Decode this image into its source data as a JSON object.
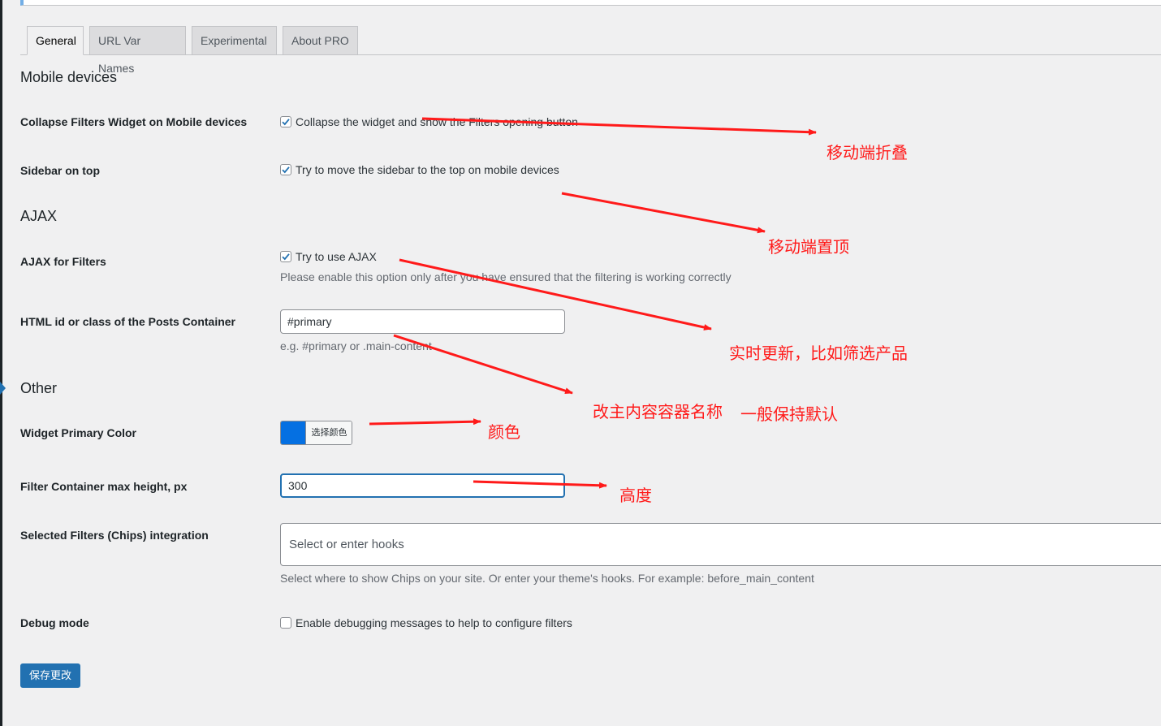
{
  "tabs": [
    {
      "label": "General",
      "active": true
    },
    {
      "label": "URL Var Names",
      "active": false
    },
    {
      "label": "Experimental",
      "active": false
    },
    {
      "label": "About PRO",
      "active": false
    }
  ],
  "sections": {
    "mobile": "Mobile devices",
    "ajax": "AJAX",
    "other": "Other"
  },
  "fields": {
    "collapse": {
      "label": "Collapse Filters Widget on Mobile devices",
      "checkbox_text": "Collapse the widget and show the Filters opening button",
      "checked": true
    },
    "sidebar_top": {
      "label": "Sidebar on top",
      "checkbox_text": "Try to move the sidebar to the top on mobile devices",
      "checked": true
    },
    "ajax_filters": {
      "label": "AJAX for Filters",
      "checkbox_text": "Try to use AJAX",
      "checked": true,
      "description": "Please enable this option only after you have ensured that the filtering is working correctly"
    },
    "posts_container": {
      "label": "HTML id or class of the Posts Container",
      "value": "#primary",
      "description": "e.g. #primary or .main-content"
    },
    "primary_color": {
      "label": "Widget Primary Color",
      "button_text": "选择颜色",
      "color": "#0570e2"
    },
    "max_height": {
      "label": "Filter Container max height, px",
      "value": "300"
    },
    "chips": {
      "label": "Selected Filters (Chips) integration",
      "placeholder": "Select or enter hooks",
      "description": "Select where to show Chips on your site. Or enter your theme's hooks. For example: before_main_content"
    },
    "debug": {
      "label": "Debug mode",
      "checkbox_text": "Enable debugging messages to help to configure filters",
      "checked": false
    }
  },
  "save_label": "保存更改",
  "annotations": {
    "collapse": "移动端折叠",
    "sidebar_top": "移动端置顶",
    "ajax": "实时更新，比如筛选产品",
    "container": "改主内容容器名称",
    "container_default": "一般保持默认",
    "color": "颜色",
    "height": "高度",
    "color_hex": "#ff1a1a"
  }
}
